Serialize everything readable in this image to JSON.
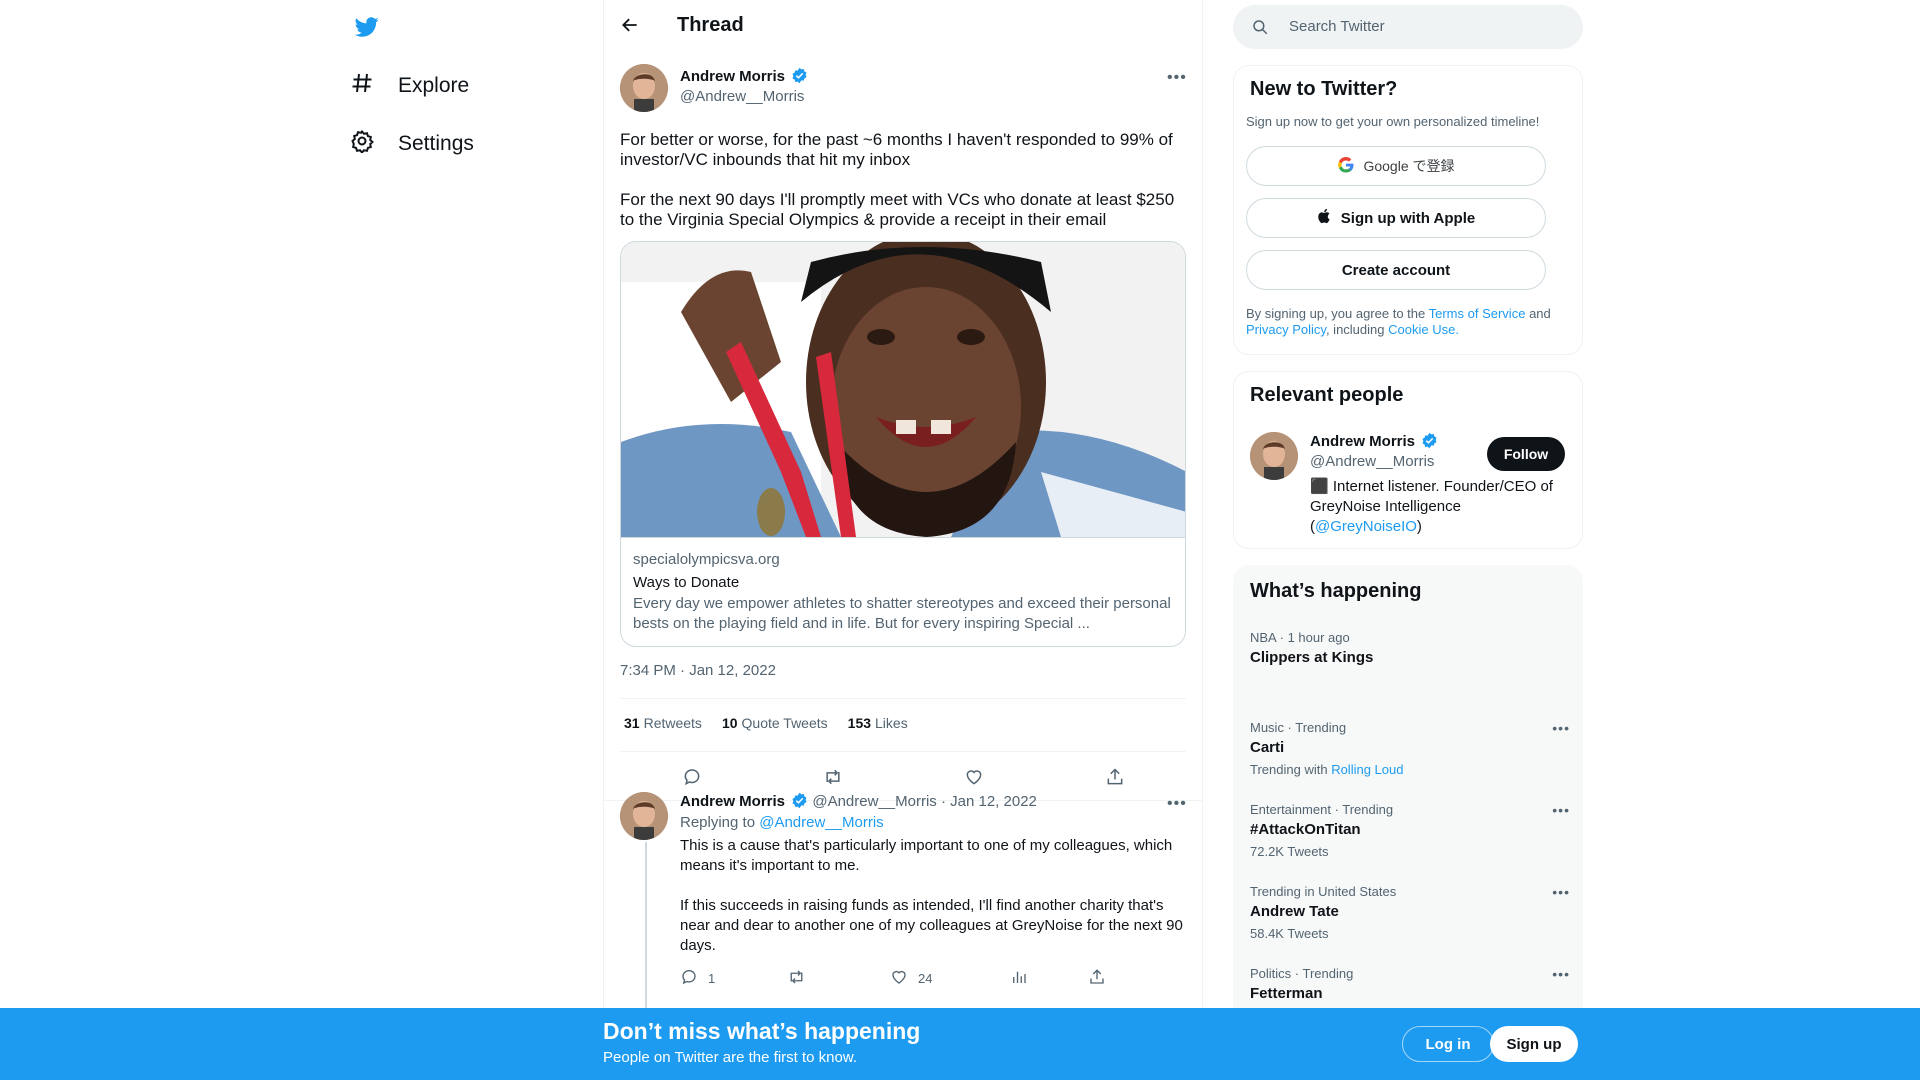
{
  "nav": {
    "logo_icon": "twitter-bird-icon",
    "items": [
      {
        "label": "Explore",
        "icon": "hashtag-icon"
      },
      {
        "label": "Settings",
        "icon": "gear-icon"
      }
    ]
  },
  "header": {
    "title": "Thread"
  },
  "tweet": {
    "author_name": "Andrew Morris",
    "author_handle": "@Andrew__Morris",
    "text_p1": "For better or worse, for the past ~6 months I haven't responded to 99% of investor/VC inbounds that hit my inbox",
    "text_p2": "For the next 90 days I'll promptly meet with VCs who donate at least $250 to the Virginia Special Olympics & provide a receipt in their email",
    "card": {
      "domain": "specialolympicsva.org",
      "title": "Ways to Donate",
      "description": "Every day we empower athletes to shatter stereotypes and exceed their personal bests on the playing field and in life. But for every inspiring Special ..."
    },
    "timestamp": "7:34 PM · Jan 12, 2022",
    "stats": {
      "retweets_count": "31",
      "retweets_label": "Retweets",
      "quotes_count": "10",
      "quotes_label": "Quote Tweets",
      "likes_count": "153",
      "likes_label": "Likes"
    }
  },
  "reply": {
    "author_name": "Andrew Morris",
    "author_handle": "@Andrew__Morris",
    "date": "· Jan 12, 2022",
    "replying_prefix": "Replying to",
    "replying_to": "@Andrew__Morris",
    "text_p1": "This is a cause that's particularly important to one of my colleagues, which means it's important to me.",
    "text_p2": "If this succeeds in raising funds as intended, I'll find another charity that's near and dear to another one of my colleagues at GreyNoise for the next 90 days.",
    "reply_count": "1",
    "like_count": "24"
  },
  "search": {
    "placeholder": "Search Twitter"
  },
  "signup_panel": {
    "title": "New to Twitter?",
    "subtitle": "Sign up now to get your own personalized timeline!",
    "google_label": "Google で登録",
    "apple_label": "Sign up with Apple",
    "create_label": "Create account",
    "terms_prefix": "By signing up, you agree to the",
    "terms_link": "Terms of Service",
    "terms_and": "and",
    "privacy_link": "Privacy Policy",
    "including": ", including",
    "cookie_link": "Cookie Use."
  },
  "relevant_people": {
    "title": "Relevant people",
    "name": "Andrew Morris",
    "handle": "@Andrew__Morris",
    "bio": "⬛ Internet listener. Founder/CEO of GreyNoise Intelligence (",
    "bio_link": "@GreyNoiseIO",
    "bio_end": ")",
    "follow_label": "Follow"
  },
  "trends": {
    "title": "What’s happening",
    "items": [
      {
        "meta": "NBA · 1 hour ago",
        "name": "Clippers at Kings",
        "sub": ""
      },
      {
        "meta": "Music · Trending",
        "name": "Carti",
        "sub": "Trending with",
        "sub_link": "Rolling Loud"
      },
      {
        "meta": "Entertainment · Trending",
        "name": "#AttackOnTitan",
        "sub": "72.2K Tweets"
      },
      {
        "meta": "Trending in United States",
        "name": "Andrew Tate",
        "sub": "58.4K Tweets"
      },
      {
        "meta": "Politics · Trending",
        "name": "Fetterman",
        "sub": ""
      }
    ]
  },
  "bottom_bar": {
    "title": "Don’t miss what’s happening",
    "subtitle": "People on Twitter are the first to know.",
    "login_label": "Log in",
    "signup_label": "Sign up"
  },
  "colors": {
    "accent": "#1d9bf0",
    "text": "#0f1419",
    "muted": "#536471"
  }
}
